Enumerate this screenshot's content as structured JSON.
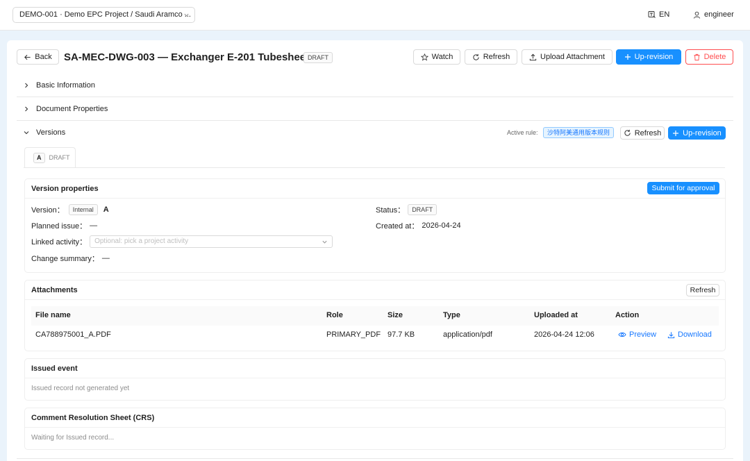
{
  "topbar": {
    "project": "DEMO-001 · Demo EPC Project / Saudi Aramco ...",
    "lang": "EN",
    "user": "engineer"
  },
  "header": {
    "back": "Back",
    "title": "SA-MEC-DWG-003 — Exchanger E-201 Tubesheet",
    "status": "DRAFT",
    "watch": "Watch",
    "refresh": "Refresh",
    "upload": "Upload Attachment",
    "uprevision": "Up-revision",
    "delete": "Delete"
  },
  "sections": {
    "basic": "Basic Information",
    "doc_props": "Document Properties",
    "versions": "Versions"
  },
  "versions": {
    "active_rule_label": "Active rule:",
    "active_rule": "沙特阿美通用版本规则",
    "refresh": "Refresh",
    "uprevision": "Up-revision",
    "tab_letter": "A",
    "tab_status": "DRAFT"
  },
  "version_props": {
    "title": "Version properties",
    "submit": "Submit for approval",
    "version_label": "Version：",
    "version_type": "Internal",
    "version_value": "A",
    "status_label": "Status：",
    "status_value": "DRAFT",
    "planned_label": "Planned issue：",
    "planned_value": "—",
    "created_label": "Created at：",
    "created_value": "2026-04-24",
    "linked_label": "Linked activity：",
    "linked_placeholder": "Optional: pick a project activity",
    "summary_label": "Change summary：",
    "summary_value": "—"
  },
  "attachments": {
    "title": "Attachments",
    "refresh": "Refresh",
    "columns": [
      "File name",
      "Role",
      "Size",
      "Type",
      "Uploaded at",
      "Action"
    ],
    "rows": [
      {
        "file": "CA788975001_A.PDF",
        "role": "PRIMARY_PDF",
        "size": "97.7 KB",
        "type": "application/pdf",
        "uploaded": "2026-04-24 12:06",
        "preview": "Preview",
        "download": "Download"
      }
    ]
  },
  "issued": {
    "title": "Issued event",
    "empty": "Issued record not generated yet"
  },
  "crs": {
    "title": "Comment Resolution Sheet (CRS)",
    "empty": "Waiting for Issued record..."
  },
  "colors": {
    "primary": "#1890ff",
    "danger": "#ff4d4f",
    "link": "#1677ff",
    "page_bg": "#eaf3fb"
  }
}
